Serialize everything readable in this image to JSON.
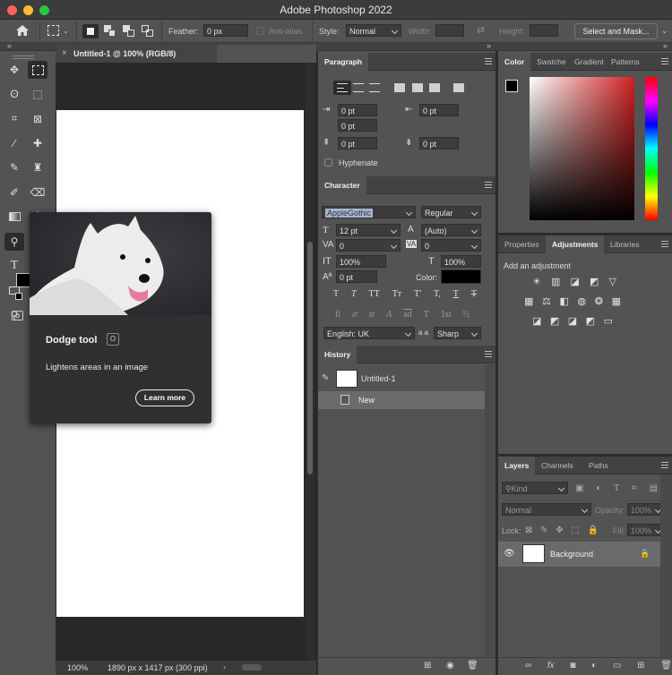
{
  "app": {
    "title": "Adobe Photoshop 2022"
  },
  "options_bar": {
    "feather_label": "Feather:",
    "feather_value": "0 px",
    "antialias_label": "Anti-alias",
    "style_label": "Style:",
    "style_value": "Normal",
    "width_label": "Width:",
    "height_label": "Height:",
    "select_mask_label": "Select and Mask..."
  },
  "document": {
    "tab_title": "Untitled-1 @ 100% (RGB/8)",
    "zoom": "100%",
    "info": "1890 px x 1417 px (300 ppi)"
  },
  "tooltip": {
    "tool_name": "Dodge tool",
    "shortcut": "O",
    "description": "Lightens areas in an image",
    "learn_more": "Learn more"
  },
  "paragraph": {
    "tab": "Paragraph",
    "indent_left": "0 pt",
    "indent_right": "0 pt",
    "indent_first": "0 pt",
    "space_before": "0 pt",
    "space_after": "0 pt",
    "hyphenate_label": "Hyphenate"
  },
  "character": {
    "tab": "Character",
    "font_family": "AppleGothic",
    "font_style": "Regular",
    "font_size": "12 pt",
    "leading": "(Auto)",
    "kerning": "0",
    "tracking": "0",
    "vertical_scale": "100%",
    "horizontal_scale": "100%",
    "baseline_shift": "0 pt",
    "color_label": "Color:",
    "language": "English: UK",
    "aa_label": "a a",
    "antialias": "Sharp",
    "style_buttons_row1": [
      "T",
      "T",
      "TT",
      "Tт",
      "T'",
      "T,",
      "T",
      "T"
    ],
    "style_buttons_row2": [
      "fi",
      "ơ",
      "st",
      "A",
      "ad",
      "T",
      "1st",
      "½"
    ]
  },
  "history": {
    "tab": "History",
    "snapshot_name": "Untitled-1",
    "states": [
      "New"
    ]
  },
  "color": {
    "tabs": [
      "Color",
      "Swatche",
      "Gradient",
      "Patterns"
    ],
    "hue_color": "#d02020"
  },
  "adjustments_panel": {
    "tabs": [
      "Properties",
      "Adjustments",
      "Libraries"
    ],
    "add_label": "Add an adjustment"
  },
  "layers": {
    "tabs": [
      "Layers",
      "Channels",
      "Paths"
    ],
    "filter_kind": "Kind",
    "blend_mode": "Normal",
    "opacity_label": "Opacity:",
    "opacity_value": "100%",
    "lock_label": "Lock:",
    "fill_label": "Fill:",
    "fill_value": "100%",
    "items": [
      {
        "name": "Background"
      }
    ]
  }
}
